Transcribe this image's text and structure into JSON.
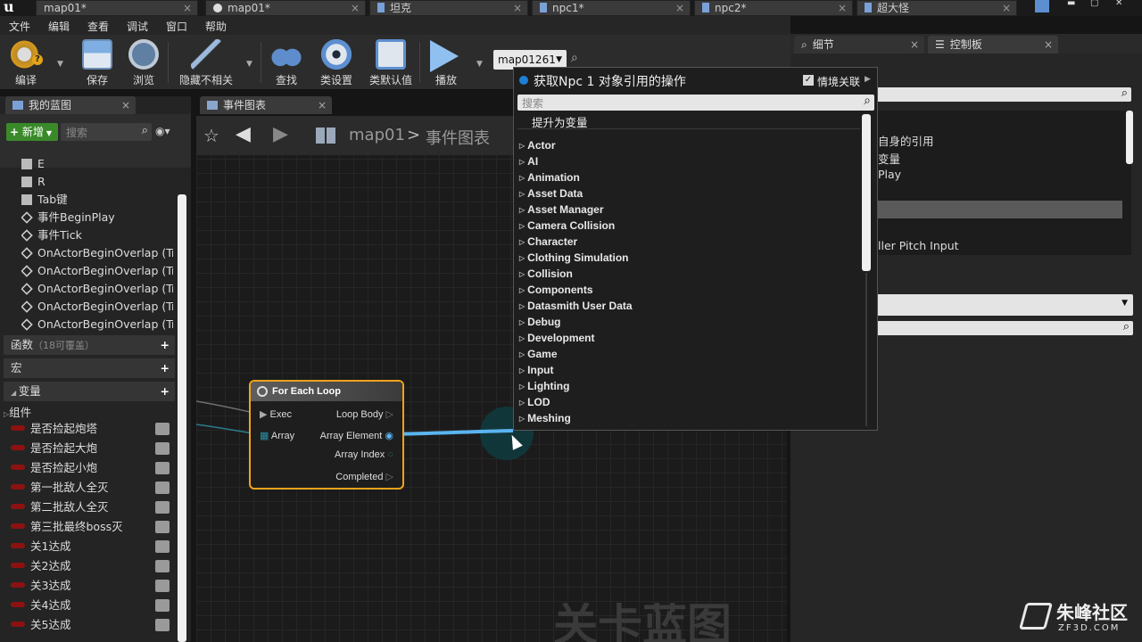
{
  "tabs": [
    {
      "label": "map01*"
    },
    {
      "label": "map01*"
    },
    {
      "label": "坦克"
    },
    {
      "label": "npc1*"
    },
    {
      "label": "npc2*"
    },
    {
      "label": "超大怪"
    }
  ],
  "menu": [
    "文件",
    "编辑",
    "查看",
    "调试",
    "窗口",
    "帮助"
  ],
  "toolbar": {
    "compile": "编译",
    "save": "保存",
    "browse": "浏览",
    "hide_unrelated": "隐藏不相关",
    "find": "查找",
    "class_settings": "类设置",
    "class_defaults": "类默认值",
    "play": "播放",
    "debug_object": "map01261"
  },
  "my_blueprint": {
    "tab_label": "我的蓝图",
    "new_button": "新增",
    "search_placeholder": "搜索",
    "items": [
      "E",
      "R",
      "Tab键",
      "事件BeginPlay",
      "事件Tick",
      "OnActorBeginOverlap (Tr",
      "OnActorBeginOverlap (Tr",
      "OnActorBeginOverlap (Tr",
      "OnActorBeginOverlap (Tr",
      "OnActorBeginOverlap (Tr"
    ],
    "functions_label": "函数",
    "functions_note": "（18可覆盖）",
    "macros_label": "宏",
    "variables_label": "变量",
    "components_label": "组件",
    "variables": [
      "是否捡起炮塔",
      "是否捡起大炮",
      "是否捡起小炮",
      "第一批敌人全灭",
      "第二批敌人全灭",
      "第三批最终boss灭",
      "关1达成",
      "关2达成",
      "关3达成",
      "关4达成",
      "关5达成"
    ]
  },
  "graph": {
    "tab_label": "事件图表",
    "breadcrumb_root": "map01",
    "breadcrumb_sep": ">",
    "breadcrumb_current": "事件图表",
    "watermark": "关卡蓝图",
    "node": {
      "title": "For Each Loop",
      "exec": "Exec",
      "array": "Array",
      "loop_body": "Loop Body",
      "array_element": "Array Element",
      "array_index": "Array Index",
      "completed": "Completed"
    }
  },
  "popup": {
    "title": "获取Npc 1 对象引用的操作",
    "context_label": "情境关联",
    "search_placeholder": "搜索",
    "promote": "提升为变量",
    "categories": [
      "Actor",
      "AI",
      "Animation",
      "Asset Data",
      "Asset Manager",
      "Camera Collision",
      "Character",
      "Clothing Simulation",
      "Collision",
      "Components",
      "Datasmith User Data",
      "Debug",
      "Development",
      "Game",
      "Input",
      "Lighting",
      "LOD",
      "Meshing"
    ]
  },
  "right_panel": {
    "details_tab": "细节",
    "palette_tab": "控制板",
    "partial_items": [
      "自身的引用",
      "变量",
      "Play",
      "ller Pitch Input"
    ]
  },
  "site_watermark": {
    "name": "朱峰社区",
    "url": "ZF3D.COM"
  },
  "colors": {
    "accent_blue": "#1e7fd6",
    "node_border": "#f2a31b",
    "wire": "#5ab4f0",
    "var_pill": "#8c1212",
    "new_button": "#3a8a2a"
  }
}
